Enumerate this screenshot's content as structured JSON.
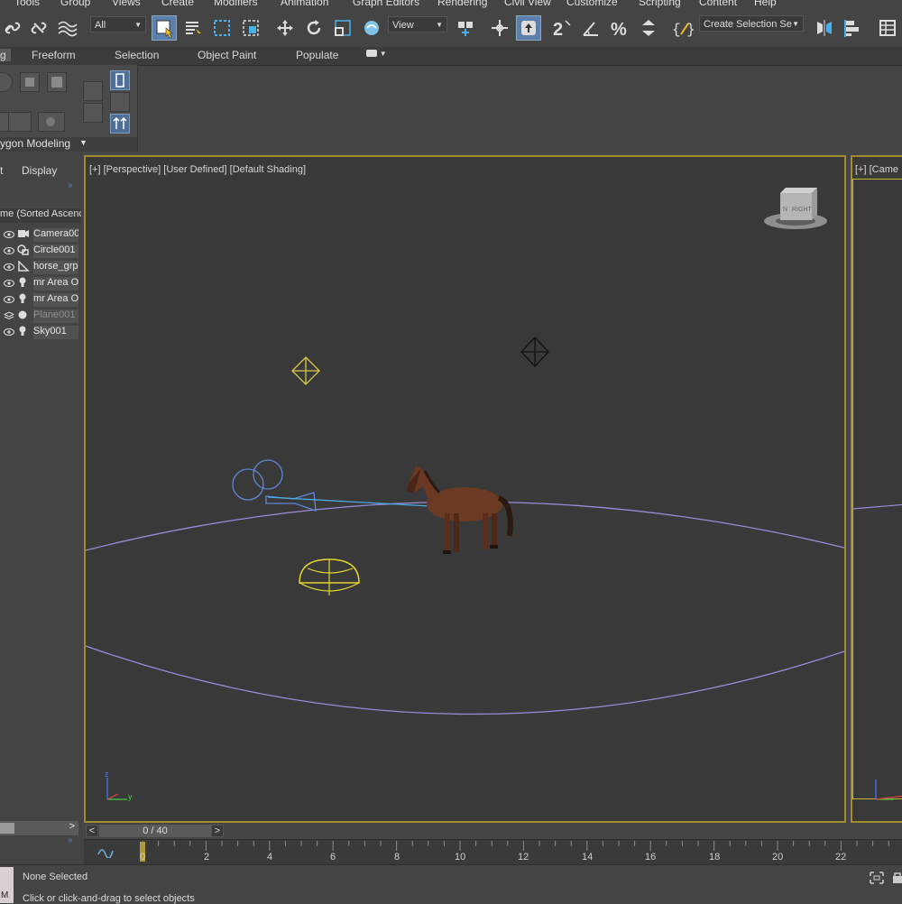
{
  "menu": [
    "Tools",
    "Group",
    "Views",
    "Create",
    "Modifiers",
    "Animation",
    "Graph Editors",
    "Rendering",
    "Civil View",
    "Customize",
    "Scripting",
    "Content",
    "Help"
  ],
  "toolbar": {
    "filter_value": "All",
    "view_value": "View",
    "selection_set": "Create Selection Se"
  },
  "ribbon_tabs": [
    "g",
    "Freeform",
    "Selection",
    "Object Paint",
    "Populate"
  ],
  "ribbon_panel_label": "ygon Modeling",
  "explorer": {
    "tabs": [
      "t",
      "Display"
    ],
    "sort_header": "me (Sorted Ascenc",
    "items": [
      {
        "name": "Camera00",
        "icon": "camera-icon"
      },
      {
        "name": "Circle001",
        "icon": "shape-icon"
      },
      {
        "name": "horse_grp",
        "icon": "bone-icon"
      },
      {
        "name": "mr Area O",
        "icon": "light-icon"
      },
      {
        "name": "mr Area O",
        "icon": "light-icon"
      },
      {
        "name": "Plane001",
        "icon": "geometry-icon",
        "dim": true
      },
      {
        "name": "Sky001",
        "icon": "light-icon"
      }
    ]
  },
  "viewport_main": {
    "label_plus": "[+]",
    "label_view": "[Perspective]",
    "label_user": "[User Defined]",
    "label_shading": "[Default Shading]",
    "viewcube_text": "RIGHT",
    "axis_z": "z",
    "axis_y": "y"
  },
  "viewport_cam": {
    "label": "[+] [Came"
  },
  "timeline": {
    "counter": "0 / 40",
    "prev": "<",
    "next": ">",
    "frame_labels": [
      "0",
      "2",
      "4",
      "6",
      "8",
      "10",
      "12",
      "14",
      "16",
      "18",
      "20",
      "22"
    ]
  },
  "status": {
    "selection": "None Selected",
    "prompt": "Click or click-and-drag to select objects",
    "maxscript_tag": "M"
  },
  "colors": {
    "active_border": "#a08c2c",
    "selected_button": "#5d7fae",
    "viewport_bg": "#393939"
  }
}
